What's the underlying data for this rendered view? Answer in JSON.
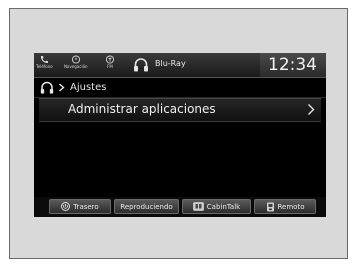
{
  "status_bar": {
    "phone_label": "Teléfono",
    "nav_label": "Navegación",
    "fm_label": "FM",
    "source_label": "Blu-Ray",
    "clock": "12:34"
  },
  "breadcrumb": {
    "title": "Ajustes"
  },
  "list": {
    "items": [
      {
        "label": "Administrar aplicaciones"
      }
    ]
  },
  "bottom_bar": {
    "rear_label": "Trasero",
    "playing_label": "Reproduciendo",
    "cabintalk_label": "CabinTalk",
    "remote_label": "Remoto"
  }
}
